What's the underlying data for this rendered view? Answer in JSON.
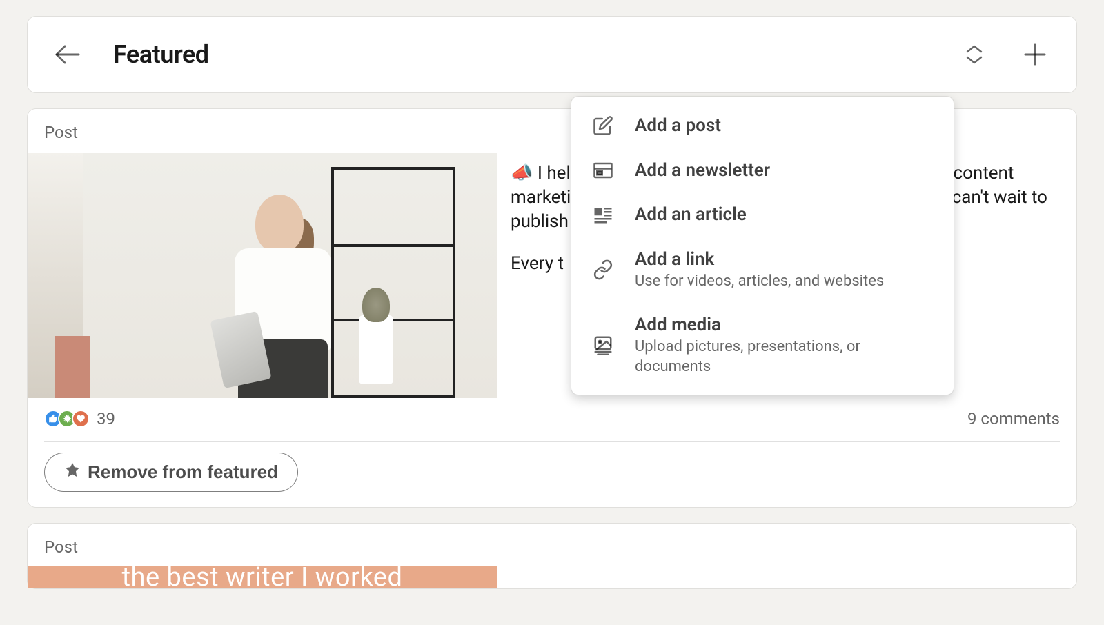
{
  "header": {
    "title": "Featured"
  },
  "post": {
    "label": "Post",
    "text_line1": "📣 I help businesses and creators with copywriting and content marketing that takes them from \"what do we write?\" to \"can't wait to publish this.\"",
    "text_line2": "Every t",
    "reactions_count": "39",
    "comments": "9 comments",
    "remove_label": "Remove from featured"
  },
  "second_post": {
    "label": "Post",
    "image_caption": "the best writer I worked"
  },
  "menu": {
    "items": [
      {
        "title": "Add a post",
        "sub": ""
      },
      {
        "title": "Add a newsletter",
        "sub": ""
      },
      {
        "title": "Add an article",
        "sub": ""
      },
      {
        "title": "Add a link",
        "sub": "Use for videos, articles, and websites"
      },
      {
        "title": "Add media",
        "sub": "Upload pictures, presentations, or documents"
      }
    ]
  }
}
